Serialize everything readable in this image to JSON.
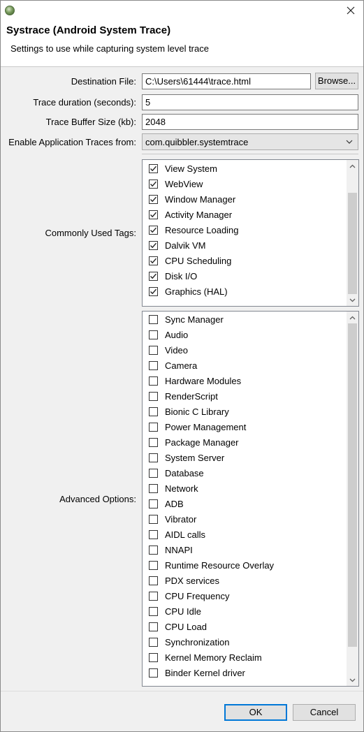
{
  "titlebar": {
    "icon": "eclipse-app-icon",
    "close_icon": "close-icon"
  },
  "dialog": {
    "title": "Systrace (Android System Trace)",
    "subtitle": "Settings to use while capturing system level trace"
  },
  "form": {
    "destination_label": "Destination File:",
    "destination_value": "C:\\Users\\61444\\trace.html",
    "browse_label": "Browse...",
    "duration_label": "Trace duration (seconds):",
    "duration_value": "5",
    "buffer_label": "Trace Buffer Size (kb):",
    "buffer_value": "2048",
    "app_traces_label": "Enable Application Traces from:",
    "app_traces_value": "com.quibbler.systemtrace"
  },
  "common_tags": {
    "label": "Commonly Used Tags:",
    "items": [
      {
        "label": "View System",
        "checked": true
      },
      {
        "label": "WebView",
        "checked": true
      },
      {
        "label": "Window Manager",
        "checked": true
      },
      {
        "label": "Activity Manager",
        "checked": true
      },
      {
        "label": "Resource Loading",
        "checked": true
      },
      {
        "label": "Dalvik VM",
        "checked": true
      },
      {
        "label": "CPU Scheduling",
        "checked": true
      },
      {
        "label": "Disk I/O",
        "checked": true
      },
      {
        "label": "Graphics (HAL)",
        "checked": true
      }
    ]
  },
  "advanced": {
    "label": "Advanced Options:",
    "items": [
      {
        "label": "Sync Manager",
        "checked": false
      },
      {
        "label": "Audio",
        "checked": false
      },
      {
        "label": "Video",
        "checked": false
      },
      {
        "label": "Camera",
        "checked": false
      },
      {
        "label": "Hardware Modules",
        "checked": false
      },
      {
        "label": "RenderScript",
        "checked": false
      },
      {
        "label": "Bionic C Library",
        "checked": false
      },
      {
        "label": "Power Management",
        "checked": false
      },
      {
        "label": "Package Manager",
        "checked": false
      },
      {
        "label": "System Server",
        "checked": false
      },
      {
        "label": "Database",
        "checked": false
      },
      {
        "label": "Network",
        "checked": false
      },
      {
        "label": "ADB",
        "checked": false
      },
      {
        "label": "Vibrator",
        "checked": false
      },
      {
        "label": "AIDL calls",
        "checked": false
      },
      {
        "label": "NNAPI",
        "checked": false
      },
      {
        "label": "Runtime Resource Overlay",
        "checked": false
      },
      {
        "label": "PDX services",
        "checked": false
      },
      {
        "label": "CPU Frequency",
        "checked": false
      },
      {
        "label": "CPU Idle",
        "checked": false
      },
      {
        "label": "CPU Load",
        "checked": false
      },
      {
        "label": "Synchronization",
        "checked": false
      },
      {
        "label": "Kernel Memory Reclaim",
        "checked": false
      },
      {
        "label": "Binder Kernel driver",
        "checked": false
      }
    ]
  },
  "buttons": {
    "ok": "OK",
    "cancel": "Cancel"
  },
  "colors": {
    "content_bg": "#f0f0f0",
    "focus_border": "#0078d7"
  }
}
